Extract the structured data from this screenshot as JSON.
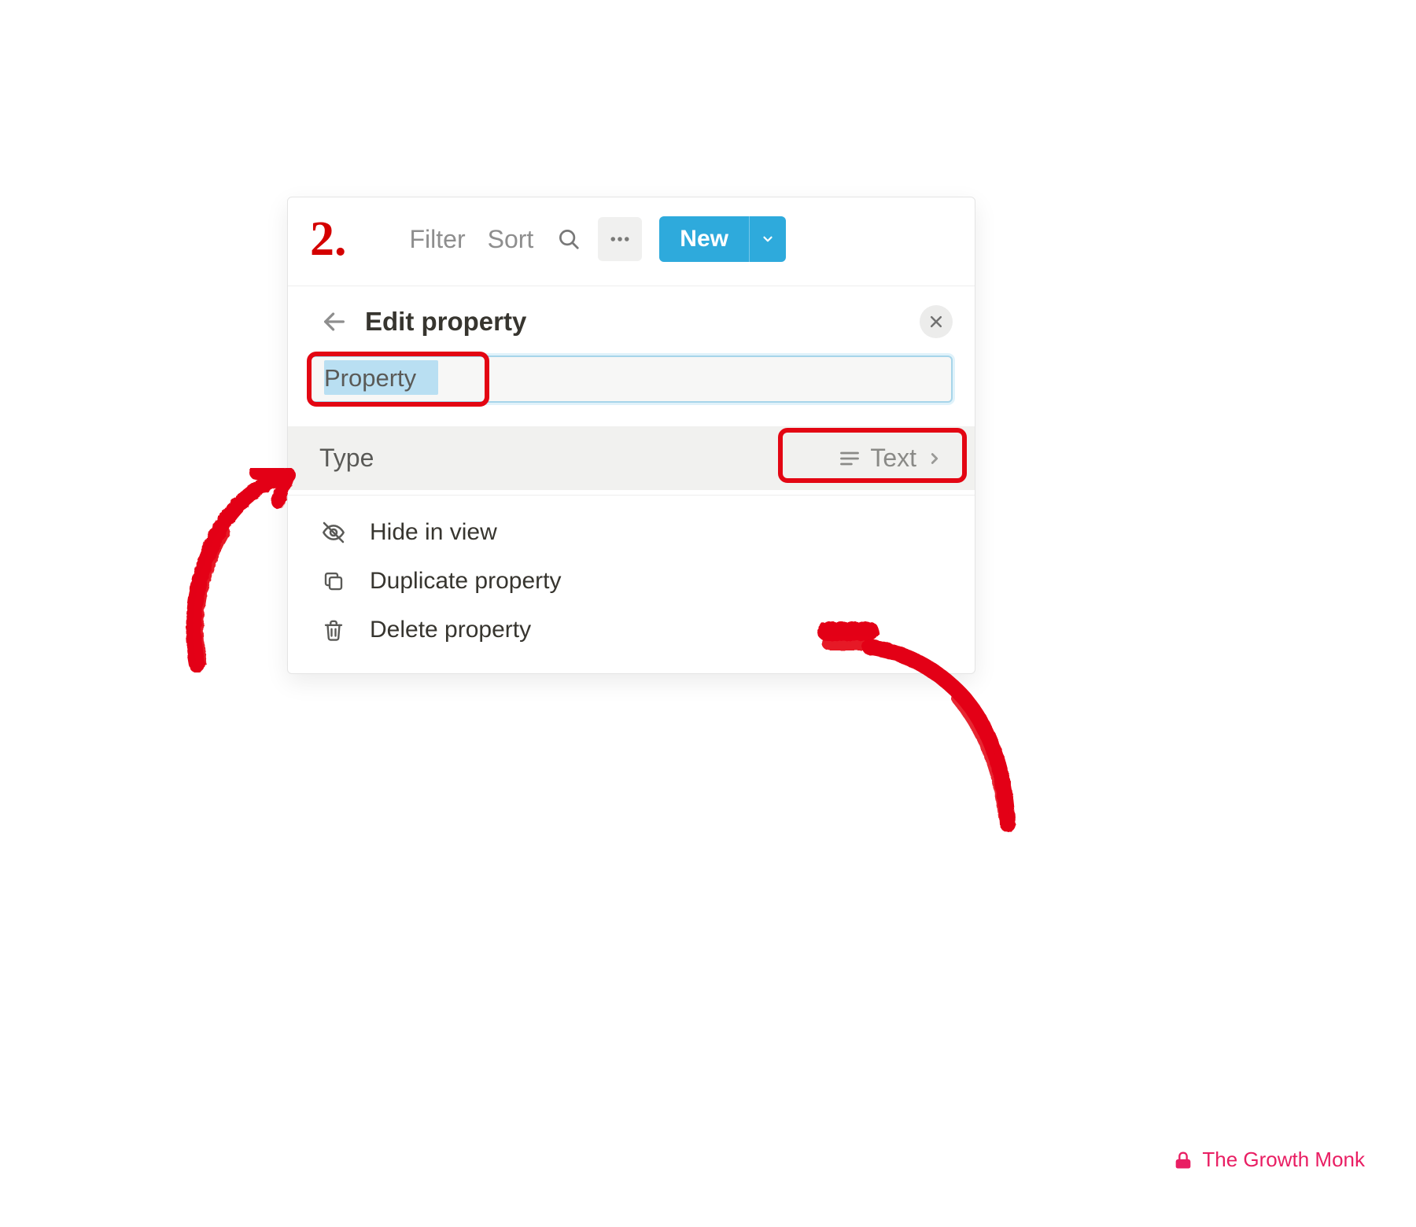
{
  "annotation": {
    "step_number": "2.",
    "highlight_color": "#e30613"
  },
  "toolbar": {
    "filter_label": "Filter",
    "sort_label": "Sort",
    "new_label": "New"
  },
  "panel": {
    "title": "Edit property",
    "property_name_value": "Property",
    "type_label": "Type",
    "type_value": "Text",
    "options": [
      {
        "icon": "eye-off-icon",
        "label": "Hide in view"
      },
      {
        "icon": "duplicate-icon",
        "label": "Duplicate property"
      },
      {
        "icon": "trash-icon",
        "label": "Delete property"
      }
    ]
  },
  "attribution": {
    "brand_name": "The Growth Monk"
  }
}
